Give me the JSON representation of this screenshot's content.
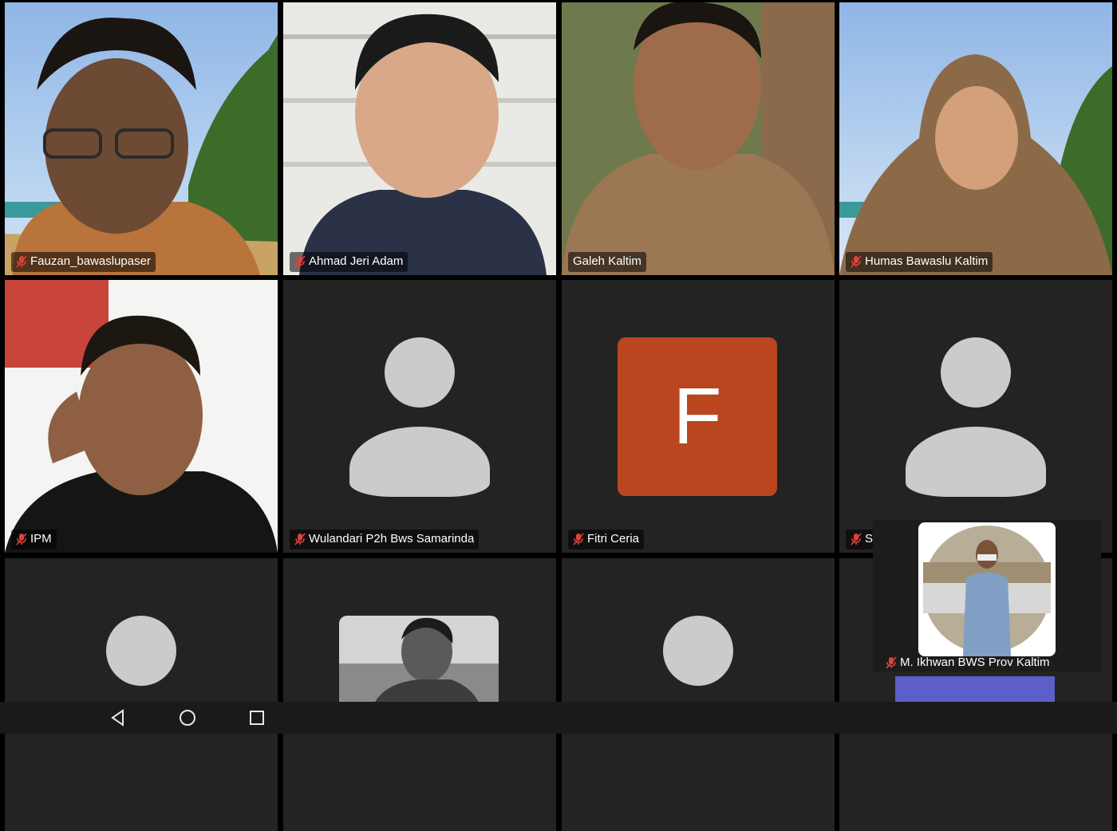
{
  "participants": [
    {
      "name": "Fauzan_bawaslupaser",
      "muted": true
    },
    {
      "name": "Ahmad Jeri Adam",
      "muted": true
    },
    {
      "name": "Galeh Kaltim",
      "muted": false,
      "speaking": true
    },
    {
      "name": "Humas Bawaslu Kaltim",
      "muted": true
    },
    {
      "name": "IPM",
      "muted": true
    },
    {
      "name": "Wulandari P2h Bws Samarinda",
      "muted": true
    },
    {
      "name": "Fitri Ceria",
      "muted": true,
      "initial": "F",
      "avatar_color": "#b9461f"
    },
    {
      "name": "S",
      "muted": true
    },
    {
      "name": "",
      "muted": false
    },
    {
      "name": "",
      "muted": false
    },
    {
      "name": "",
      "muted": false
    },
    {
      "name": "",
      "muted": false
    }
  ],
  "floating_video": {
    "name": "M. Ikhwan BWS Prov Kaltim",
    "muted": true
  },
  "colors": {
    "speaking_border": "#3fcf4a",
    "mic_muted": "#e0413a",
    "tile_bg": "#232323"
  },
  "navigation": {
    "back": "back-icon",
    "home": "home-icon",
    "recents": "recents-icon"
  }
}
